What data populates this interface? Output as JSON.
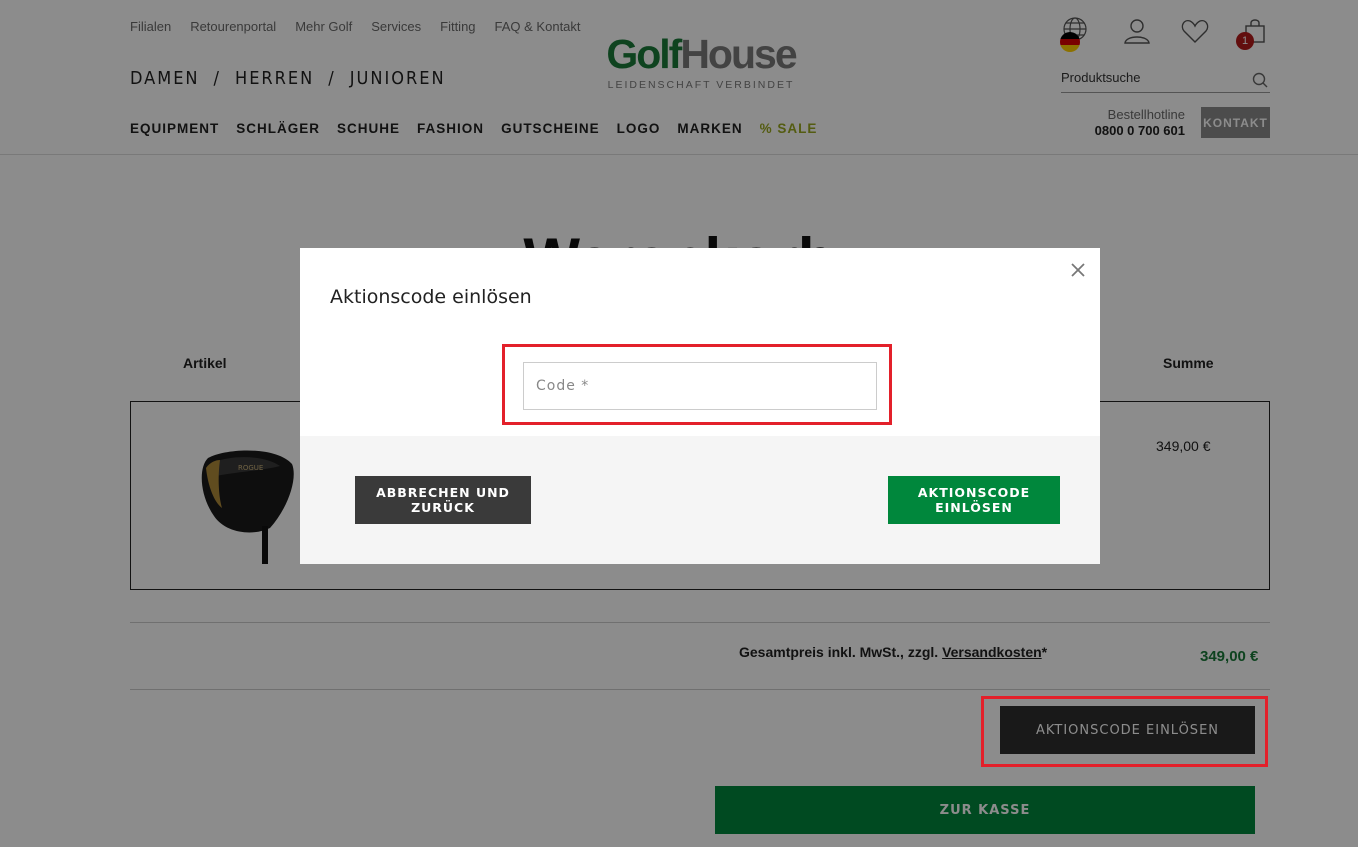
{
  "header": {
    "top_links": [
      "Filialen",
      "Retourenportal",
      "Mehr Golf",
      "Services",
      "Fitting",
      "FAQ & Kontakt"
    ],
    "gender_nav": [
      "DAMEN",
      "HERREN",
      "JUNIOREN"
    ],
    "gender_separator": "/",
    "main_nav": [
      "EQUIPMENT",
      "SCHLÄGER",
      "SCHUHE",
      "FASHION",
      "GUTSCHEINE",
      "LOGO",
      "MARKEN",
      "% SALE"
    ],
    "logo": {
      "part1": "Golf",
      "part2": "House",
      "tagline": "LEIDENSCHAFT VERBINDET"
    },
    "search_placeholder": "Produktsuche",
    "hotline_label": "Bestellhotline",
    "hotline_number": "0800 0 700 601",
    "kontakt_label": "KONTAKT",
    "cart_count": "1",
    "icons": [
      "globe-icon",
      "user-icon",
      "heart-icon",
      "bag-icon",
      "search-icon"
    ]
  },
  "cart": {
    "title": "Warenkorb",
    "col_article": "Artikel",
    "col_sum": "Summe",
    "item_price": "349,00 €",
    "total_label": "Gesamtpreis inkl. MwSt., zzgl. ",
    "total_link": "Versandkosten",
    "total_suffix": "*",
    "total_value": "349,00 €",
    "promo_button": "AKTIONSCODE EINLÖSEN",
    "checkout_button": "ZUR KASSE"
  },
  "modal": {
    "title": "Aktionscode einlösen",
    "code_placeholder": "Code *",
    "code_value": "",
    "cancel_label": "ABBRECHEN UND ZURÜCK",
    "redeem_label": "AKTIONSCODE EINLÖSEN"
  },
  "colors": {
    "brand_green": "#00873c",
    "dark_button": "#2f2f2f",
    "highlight": "#e3202a",
    "sale": "#9aa820"
  }
}
